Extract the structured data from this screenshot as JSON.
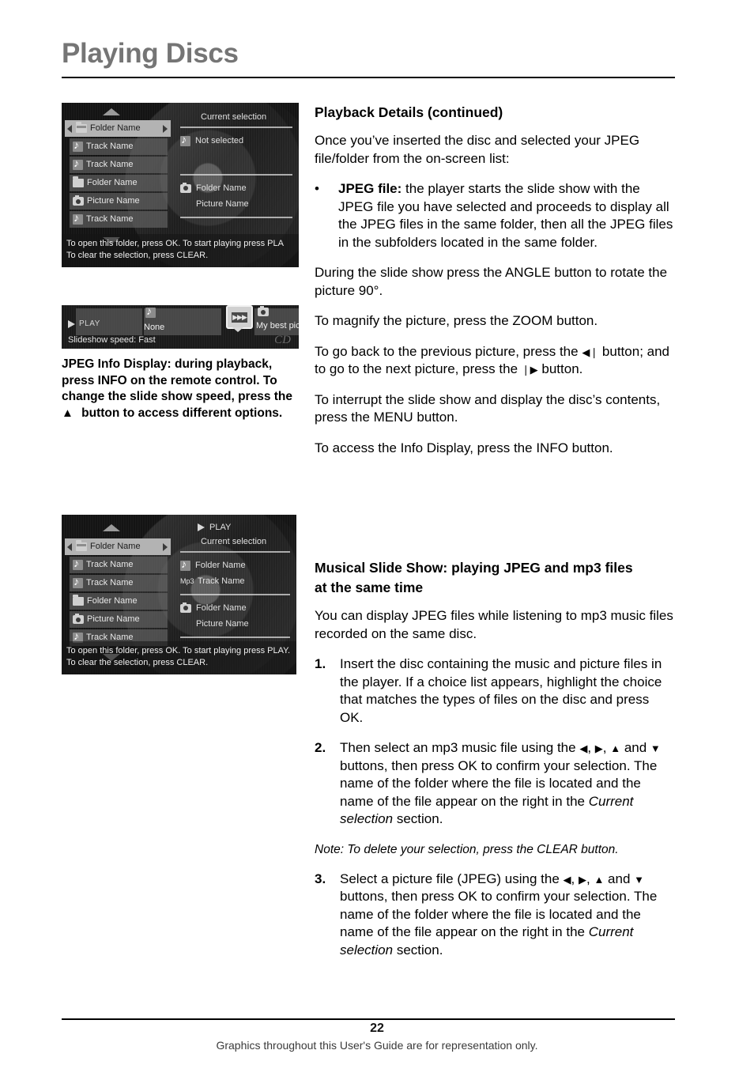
{
  "document": {
    "title": "Playing Discs",
    "page_number": "22",
    "footer_note": "Graphics throughout this User's Guide are for representation only."
  },
  "screenshot_browser": {
    "list": [
      {
        "icon": "folder-icon",
        "label": "Folder Name",
        "selected": true
      },
      {
        "icon": "music-note-icon",
        "label": "Track Name",
        "selected": false
      },
      {
        "icon": "music-note-icon",
        "label": "Track Name",
        "selected": false
      },
      {
        "icon": "folder-icon",
        "label": "Folder Name",
        "selected": false
      },
      {
        "icon": "camera-icon",
        "label": "Picture Name",
        "selected": false
      },
      {
        "icon": "music-note-icon",
        "label": "Track Name",
        "selected": false
      }
    ],
    "right_panel": {
      "heading": "Current selection",
      "audio_entry": "Not selected",
      "picture_folder": "Folder Name",
      "picture_name": "Picture Name"
    },
    "help_line_1": "To open this folder, press OK. To start playing press PLA",
    "help_line_2": "To clear the selection, press CLEAR."
  },
  "screenshot_info_display": {
    "play_label": "PLAY",
    "audio_value": "None",
    "picture_value": "My best picture",
    "slideshow_speed": "Slideshow speed: Fast",
    "disc_logo": "CD"
  },
  "caption_info_display": {
    "line1_bold": "JPEG Info Display: during playback,",
    "line2": "press INFO on the remote control. To",
    "line3": "change the slide show speed, press the",
    "line4": "button to access different options.",
    "arrow_glyph": "▲"
  },
  "screenshot_musical": {
    "play_label": "PLAY",
    "list": [
      {
        "icon": "folder-icon",
        "label": "Folder Name",
        "selected": true
      },
      {
        "icon": "music-note-icon",
        "label": "Track Name",
        "selected": false
      },
      {
        "icon": "music-note-icon",
        "label": "Track Name",
        "selected": false
      },
      {
        "icon": "folder-icon",
        "label": "Folder Name",
        "selected": false
      },
      {
        "icon": "camera-icon",
        "label": "Picture Name",
        "selected": false
      },
      {
        "icon": "music-note-icon",
        "label": "Track Name",
        "selected": false
      }
    ],
    "right_panel": {
      "heading": "Current selection",
      "audio_folder": "Folder Name",
      "mp3_indicator": "Mp3",
      "audio_track": "Track Name",
      "picture_folder": "Folder Name",
      "picture_name": "Picture Name"
    },
    "help_line_1": "To open this folder, press OK. To start playing press PLAY.",
    "help_line_2": "To clear the selection, press CLEAR."
  },
  "section_playback": {
    "heading": "Playback Details (continued)",
    "intro": "Once you’ve inserted the disc and selected your JPEG file/folder from the on-screen list:",
    "bullet_mark": "•",
    "bullet_label": "JPEG file:",
    "bullet_text": " the player starts the slide show with the JPEG file you have selected and proceeds to display all the JPEG files in the same folder, then all the JPEG files in the subfolders located in the same folder.",
    "para_angle": "During the slide show press the ANGLE button to rotate the picture 90°.",
    "para_zoom": "To magnify the picture, press the ZOOM button.",
    "para_prev_a": "To go back to the previous picture, press the ",
    "para_prev_glyph": "◀❘",
    "para_prev_b": " button; and to go to the next picture, press the ",
    "para_next_glyph": "❘▶",
    "para_prev_c": " button.",
    "para_menu": "To interrupt the slide show and display the disc’s contents, press the MENU button.",
    "para_info": "To access the Info Display, press the INFO button."
  },
  "section_musical": {
    "heading_line1": "Musical Slide Show: playing JPEG and mp3 files",
    "heading_line2": "at the same time",
    "intro": "You can display JPEG files while listening to mp3 music files recorded on the same disc.",
    "steps": [
      {
        "num": "1.",
        "text": "Insert the disc containing the music and picture files in the player. If a choice list appears,  highlight the choice that matches the types of files on the disc and press OK."
      },
      {
        "num": "2.",
        "text_a": "Then select an mp3 music file using the ",
        "glyph_left": "◀",
        "glyph_right": "▶",
        "glyph_up": "▲",
        "glyph_down": "▼",
        "text_b": " and ",
        "text_c": " buttons, then press OK to confirm your selection. The name of the folder where the file is located and the name of the file appear on the right in the ",
        "italic": "Current selection",
        "text_d": " section."
      },
      {
        "num": "3.",
        "text_a": "Select a picture file (JPEG) using the ",
        "text_b": " and ",
        "text_c": " buttons, then press OK to confirm your selection. The name of the folder where the file is located and the name of the file appear on the right in the ",
        "italic": "Current selection",
        "text_d": " section."
      }
    ],
    "note": "Note: To delete your selection, press the CLEAR button."
  }
}
